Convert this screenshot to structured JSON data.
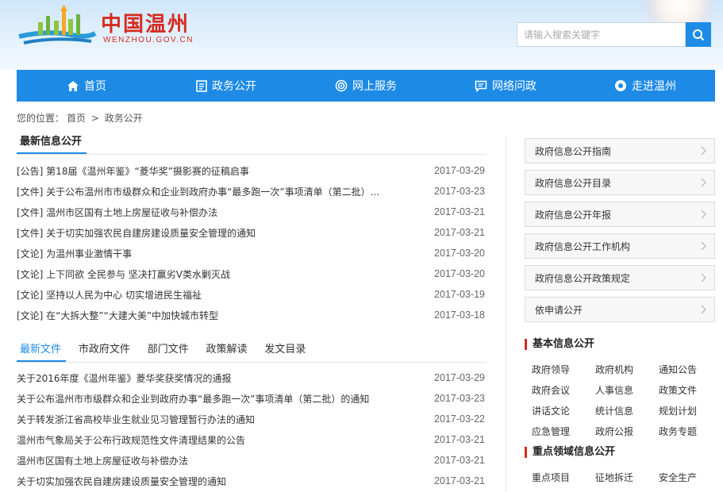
{
  "header": {
    "site_title": "中国温州",
    "site_domain": "WENZHOU.GOV.CN",
    "search_placeholder": "请输入搜索关键字",
    "icons": {
      "search": "search-icon"
    }
  },
  "nav": {
    "items": [
      {
        "label": "首页",
        "icon": "home-icon"
      },
      {
        "label": "政务公开",
        "icon": "document-icon"
      },
      {
        "label": "网上服务",
        "icon": "broadcast-icon"
      },
      {
        "label": "网络问政",
        "icon": "chat-icon"
      },
      {
        "label": "走进温州",
        "icon": "eye-icon"
      }
    ],
    "color": "#1d8be6"
  },
  "breadcrumb": {
    "prefix": "您的位置：",
    "home": "首页",
    "sep": ">",
    "current": "政务公开"
  },
  "latest": {
    "heading": "最新信息公开",
    "items": [
      {
        "title": "[公告]  第18届《温州年鉴》“菱华奖”摄影赛的征稿启事",
        "date": "2017-03-29"
      },
      {
        "title": "[文件]  关于公布温州市市级群众和企业到政府办事“最多跑一次”事项清单（第二批）...",
        "date": "2017-03-23"
      },
      {
        "title": "[文件]  温州市区国有土地上房屋征收与补偿办法",
        "date": "2017-03-21"
      },
      {
        "title": "[文件]  关于切实加强农民自建房建设质量安全管理的通知",
        "date": "2017-03-21"
      },
      {
        "title": "[文论]  为温州事业激情干事",
        "date": "2017-03-20"
      },
      {
        "title": "[文论]  上下同欲 全民参与 坚决打赢劣V类水剿灭战",
        "date": "2017-03-20"
      },
      {
        "title": "[文论]  坚持以人民为中心 切实增进民生福祉",
        "date": "2017-03-19"
      },
      {
        "title": "[文论]  在“大拆大整”“大建大美”中加快城市转型",
        "date": "2017-03-18"
      }
    ]
  },
  "files": {
    "tabs": [
      "最新文件",
      "市政府文件",
      "部门文件",
      "政策解读",
      "发文目录"
    ],
    "active_tab": 0,
    "items": [
      {
        "title": "关于2016年度《温州年鉴》菱华奖获奖情况的通报",
        "date": "2017-03-29"
      },
      {
        "title": "关于公布温州市市级群众和企业到政府办事“最多跑一次”事项清单（第二批）的通知",
        "date": "2017-03-23"
      },
      {
        "title": "关于转发浙江省高校毕业生就业见习管理暂行办法的通知",
        "date": "2017-03-22"
      },
      {
        "title": "温州市气象局关于公布行政规范性文件清理结果的公告",
        "date": "2017-03-21"
      },
      {
        "title": "温州市区国有土地上房屋征收与补偿办法",
        "date": "2017-03-21"
      },
      {
        "title": "关于切实加强农民自建房建设质量安全管理的通知",
        "date": "2017-03-21"
      }
    ]
  },
  "sidebar": {
    "buttons": [
      "政府信息公开指南",
      "政府信息公开目录",
      "政府信息公开年报",
      "政府信息公开工作机构",
      "政府信息公开政策规定",
      "依申请公开"
    ],
    "basic": {
      "heading": "基本信息公开",
      "links": [
        "政府领导",
        "政府机构",
        "通知公告",
        "政府会议",
        "人事信息",
        "政策文件",
        "讲话文论",
        "统计信息",
        "规划计划",
        "应急管理",
        "政府公报",
        "政务专题"
      ]
    },
    "key": {
      "heading": "重点领域信息公开",
      "links": [
        "重点项目",
        "征地拆迁",
        "安全生产"
      ]
    },
    "accent": "#d9291c"
  }
}
